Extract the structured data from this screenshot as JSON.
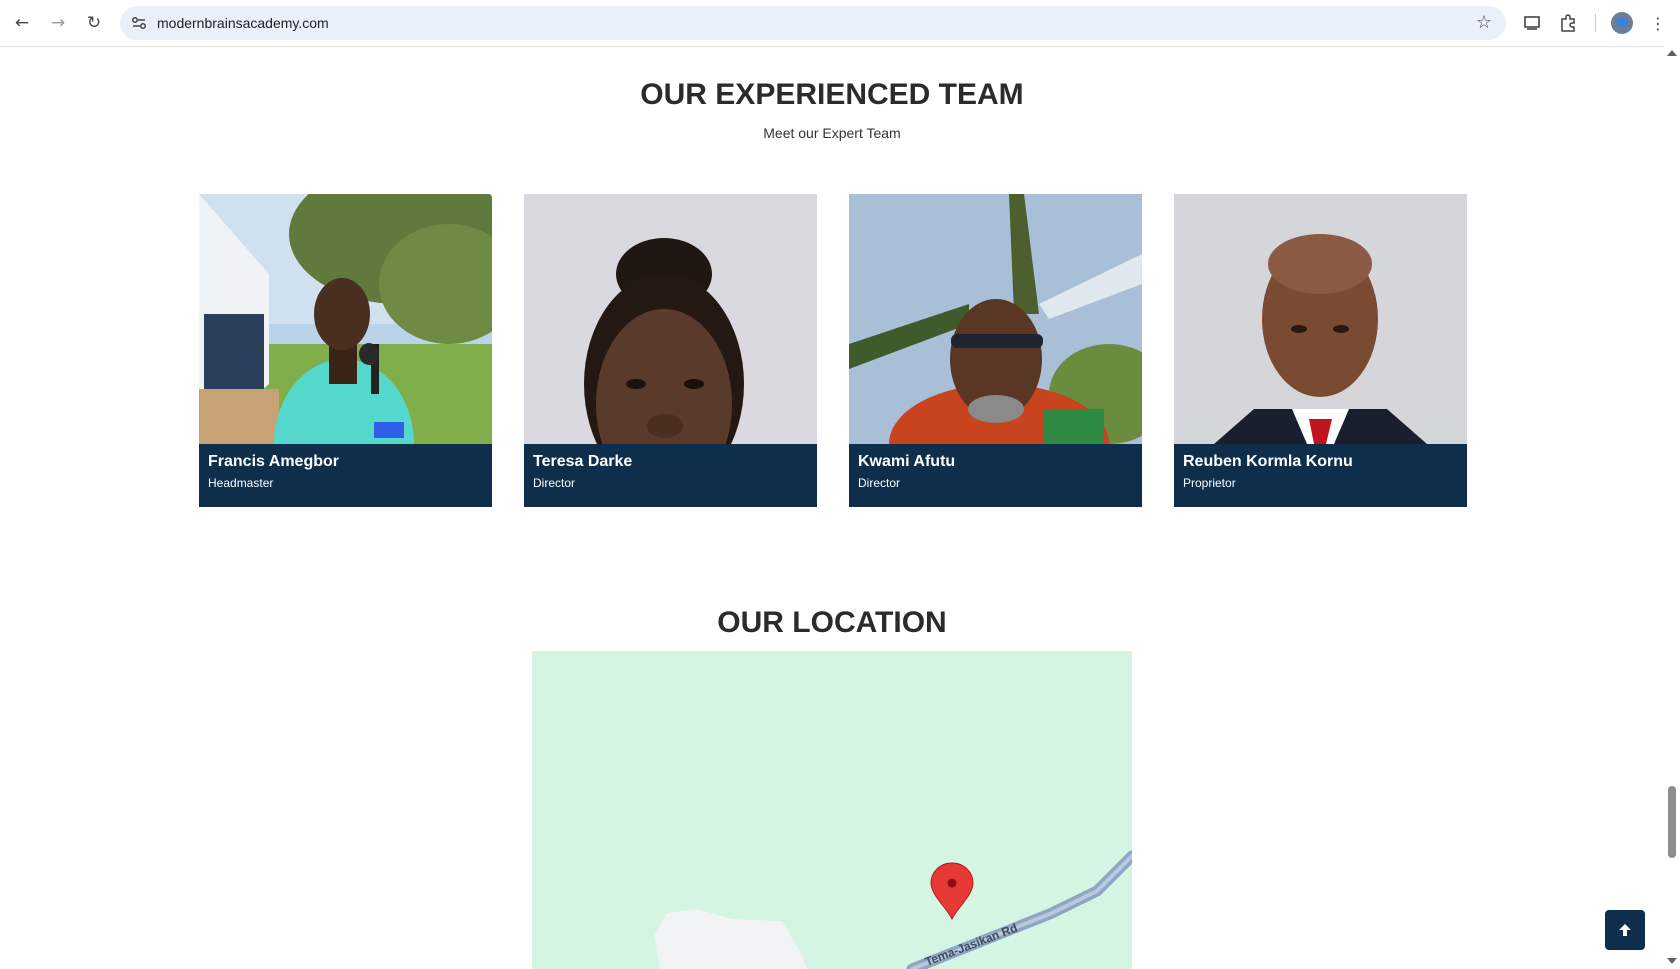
{
  "browser": {
    "url": "modernbrainsacademy.com",
    "icons": [
      "back-icon",
      "forward-icon",
      "reload-icon",
      "site-info-icon",
      "star-icon",
      "cast-icon",
      "extensions-icon",
      "profile-avatar",
      "menu-icon"
    ]
  },
  "team": {
    "title": "OUR EXPERIENCED TEAM",
    "subtitle": "Meet our Expert Team",
    "members": [
      {
        "name": "Francis Amegbor",
        "role": "Headmaster"
      },
      {
        "name": "Teresa Darke",
        "role": "Director"
      },
      {
        "name": "Kwami Afutu",
        "role": "Director"
      },
      {
        "name": "Reuben Kormla Kornu",
        "role": "Proprietor"
      }
    ]
  },
  "location": {
    "title": "OUR LOCATION",
    "map_road_label": "Tema-Jasikan Rd",
    "colors": {
      "land": "#d3f5e2",
      "road": "#8ea5c4",
      "marker": "#e53935"
    }
  },
  "colors": {
    "card_bg": "#0f2e4c",
    "heading": "#2b2b2b",
    "omnibox": "#eaf0fa"
  },
  "back_to_top": {
    "icon": "arrow-up-icon"
  }
}
